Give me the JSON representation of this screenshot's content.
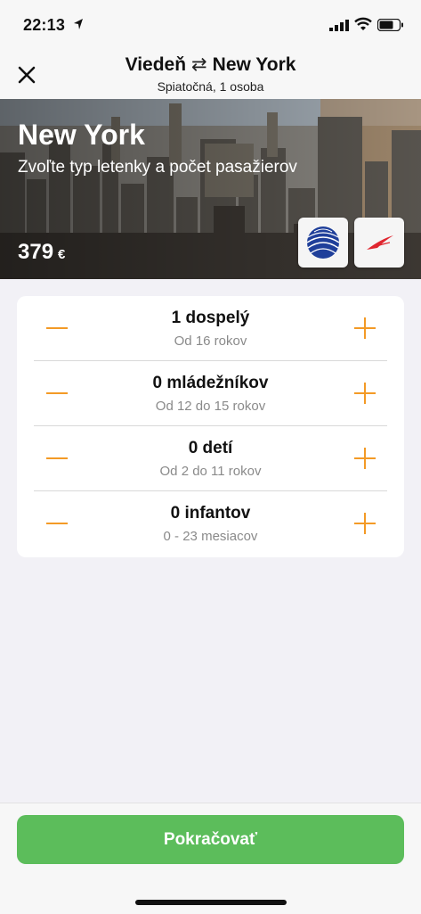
{
  "status": {
    "time": "22:13"
  },
  "header": {
    "origin": "Viedeň",
    "swap_symbol": "⇄",
    "destination": "New York",
    "subtitle": "Spiatočná, 1 osoba"
  },
  "hero": {
    "title": "New York",
    "subtitle": "Zvoľte typ letenky a počet pasažierov",
    "price": "379",
    "currency": "€",
    "airlines": [
      "united-airlines-logo",
      "austrian-airlines-logo"
    ]
  },
  "passengers": [
    {
      "label": "1 dospelý",
      "age": "Od 16 rokov"
    },
    {
      "label": "0 mládežníkov",
      "age": "Od 12 do 15 rokov"
    },
    {
      "label": "0 detí",
      "age": "Od 2 do 11 rokov"
    },
    {
      "label": "0 infantov",
      "age": "0 - 23 mesiacov"
    }
  ],
  "footer": {
    "continue_label": "Pokračovať"
  },
  "colors": {
    "accent": "#f39a26",
    "primary_button": "#5cbd5b"
  }
}
